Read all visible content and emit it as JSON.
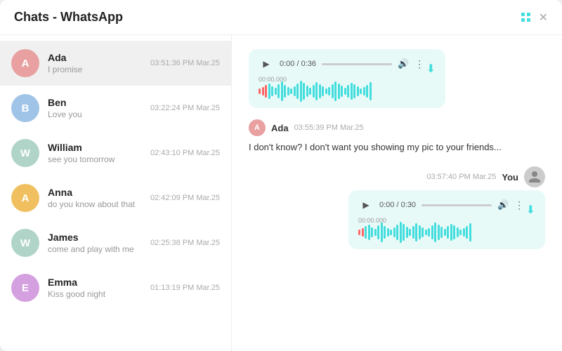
{
  "window": {
    "title": "Chats - WhatsApp"
  },
  "chats": [
    {
      "id": "ada",
      "name": "Ada",
      "preview": "I promise",
      "time": "03:51:36 PM Mar.25",
      "avatar_color": "#e8a0a0",
      "avatar_letter": "A",
      "active": true
    },
    {
      "id": "ben",
      "name": "Ben",
      "preview": "Love you",
      "time": "03:22:24 PM Mar.25",
      "avatar_color": "#a0c4e8",
      "avatar_letter": "B",
      "active": false
    },
    {
      "id": "william",
      "name": "William",
      "preview": "see you tomorrow",
      "time": "02:43:10 PM Mar.25",
      "avatar_color": "#b0d4c8",
      "avatar_letter": "W",
      "active": false
    },
    {
      "id": "anna",
      "name": "Anna",
      "preview": "do you know about that",
      "time": "02:42:09 PM Mar.25",
      "avatar_color": "#f0c060",
      "avatar_letter": "A",
      "active": false
    },
    {
      "id": "james",
      "name": "James",
      "preview": "come and play with me",
      "time": "02:25:38 PM Mar.25",
      "avatar_color": "#b0d4c8",
      "avatar_letter": "W",
      "active": false
    },
    {
      "id": "emma",
      "name": "Emma",
      "preview": "Kiss good night",
      "time": "01:13:19 PM Mar.25",
      "avatar_color": "#d4a0e0",
      "avatar_letter": "E",
      "active": false
    }
  ],
  "messages": [
    {
      "id": "msg1",
      "type": "audio_incoming",
      "audio_time": "0:00 / 0:36",
      "duration_label": "0:36"
    },
    {
      "id": "msg2",
      "type": "text_incoming",
      "sender": "Ada",
      "sender_letter": "A",
      "sender_color": "#e8a0a0",
      "time": "03:55:39 PM Mar.25",
      "text": "I don't know? I don't want you showing my pic to your friends..."
    },
    {
      "id": "msg3",
      "type": "audio_outgoing",
      "time": "03:57:40 PM Mar.25",
      "sender": "You",
      "audio_time": "0:00 / 0:30",
      "duration_label": "0:30"
    }
  ],
  "labels": {
    "play": "▶",
    "download": "⬇",
    "volume": "🔊",
    "more": "⋮",
    "close": "✕"
  }
}
